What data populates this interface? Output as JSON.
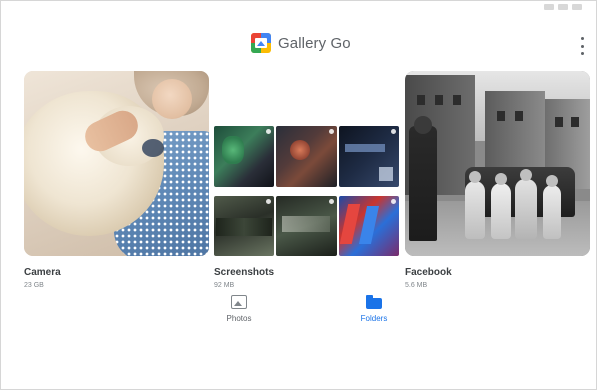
{
  "header": {
    "title": "Gallery Go",
    "logo_icon": "gallery-go-logo",
    "menu_icon": "more-vert-icon"
  },
  "albums": [
    {
      "name": "Camera",
      "size": "23 GB"
    },
    {
      "name": "Screenshots",
      "size": "92 MB"
    },
    {
      "name": "Facebook",
      "size": "5.6 MB"
    }
  ],
  "nav": {
    "photos_label": "Photos",
    "folders_label": "Folders",
    "active": "Folders"
  },
  "colors": {
    "accent": "#1a73e8",
    "inactive": "#80868b"
  }
}
